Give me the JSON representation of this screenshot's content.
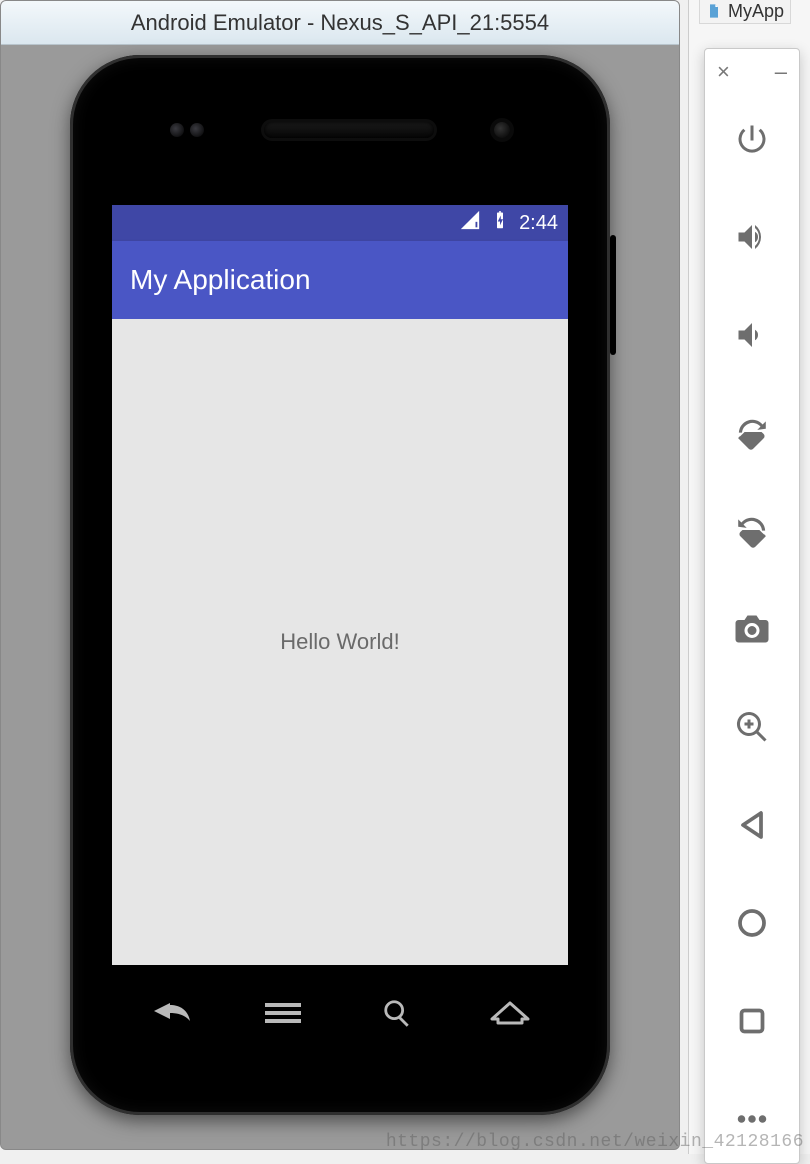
{
  "emulator": {
    "window_title": "Android Emulator - Nexus_S_API_21:5554",
    "device_name": "Nexus_S_API_21",
    "port": "5554"
  },
  "android": {
    "status_time": "2:44",
    "app_title": "My Application",
    "content_text": "Hello World!"
  },
  "soft_keys": {
    "back": "back",
    "menu": "menu",
    "search": "search",
    "home": "home"
  },
  "toolbar": {
    "close": "×",
    "minimize": "–",
    "buttons": [
      {
        "name": "power-icon",
        "label": "Power"
      },
      {
        "name": "volume-up-icon",
        "label": "Volume up"
      },
      {
        "name": "volume-down-icon",
        "label": "Volume down"
      },
      {
        "name": "rotate-left-icon",
        "label": "Rotate left"
      },
      {
        "name": "rotate-right-icon",
        "label": "Rotate right"
      },
      {
        "name": "camera-icon",
        "label": "Screenshot"
      },
      {
        "name": "zoom-in-icon",
        "label": "Zoom"
      },
      {
        "name": "nav-back-icon",
        "label": "Back"
      },
      {
        "name": "nav-home-icon",
        "label": "Home"
      },
      {
        "name": "nav-overview-icon",
        "label": "Overview"
      },
      {
        "name": "more-icon",
        "label": "More"
      }
    ]
  },
  "ide": {
    "tab_label": "MyApp"
  },
  "watermark": "https://blog.csdn.net/weixin_42128166"
}
